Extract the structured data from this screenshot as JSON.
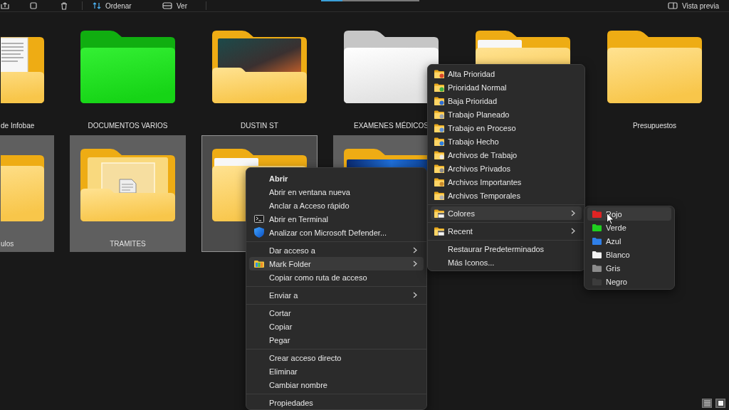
{
  "toolbar": {
    "sort_button": "Ordenar",
    "view_button": "Ver",
    "preview_button": "Vista previa"
  },
  "folders": [
    {
      "label": "de Infobae",
      "kind": "papers",
      "selected": false,
      "focused": false
    },
    {
      "label": "DOCUMENTOS VARIOS",
      "kind": "green",
      "selected": false,
      "focused": false
    },
    {
      "label": "DUSTIN ST",
      "kind": "photo",
      "selected": false,
      "focused": false
    },
    {
      "label": "EXAMENES MÉDICOS",
      "kind": "white",
      "selected": false,
      "focused": false
    },
    {
      "kind": "sheet",
      "selected": false,
      "focused": false
    },
    {
      "label": "Presupuestos",
      "kind": "plain",
      "selected": false,
      "focused": false
    },
    {
      "label": "ulos",
      "kind": "plain",
      "selected": true,
      "focused": false
    },
    {
      "label": "TRAMITES",
      "kind": "thumbnail",
      "selected": true,
      "focused": false
    },
    {
      "kind": "sheet",
      "selected": true,
      "focused": true
    },
    {
      "kind": "wallpaper",
      "selected": true,
      "focused": false
    }
  ],
  "context_menu": {
    "groups": [
      {
        "items": [
          {
            "label": "Abrir",
            "kind": "default",
            "submenu": false,
            "selected": false
          },
          {
            "label": "Abrir en ventana nueva",
            "kind": "plain",
            "submenu": false,
            "selected": false
          },
          {
            "label": "Anclar a Acceso rápido",
            "kind": "plain",
            "submenu": false,
            "selected": false
          },
          {
            "label": "Abrir en Terminal",
            "kind": "terminal",
            "submenu": false,
            "selected": false
          },
          {
            "label": "Analizar con Microsoft Defender...",
            "kind": "shield",
            "submenu": false,
            "selected": false
          }
        ]
      },
      {
        "items": [
          {
            "label": "Dar acceso a",
            "kind": "plain",
            "submenu": true,
            "selected": false
          },
          {
            "label": "Mark Folder",
            "kind": "tag",
            "submenu": true,
            "selected": true
          },
          {
            "label": "Copiar como ruta de acceso",
            "kind": "plain",
            "submenu": false,
            "selected": false
          }
        ]
      },
      {
        "items": [
          {
            "label": "Enviar a",
            "kind": "plain",
            "submenu": true,
            "selected": false
          }
        ]
      },
      {
        "items": [
          {
            "label": "Cortar",
            "kind": "plain",
            "submenu": false,
            "selected": false
          },
          {
            "label": "Copiar",
            "kind": "plain",
            "submenu": false,
            "selected": false
          },
          {
            "label": "Pegar",
            "kind": "plain",
            "submenu": false,
            "selected": false
          }
        ]
      },
      {
        "items": [
          {
            "label": "Crear acceso directo",
            "kind": "plain",
            "submenu": false,
            "selected": false
          },
          {
            "label": "Eliminar",
            "kind": "plain",
            "submenu": false,
            "selected": false
          },
          {
            "label": "Cambiar nombre",
            "kind": "plain",
            "submenu": false,
            "selected": false
          }
        ]
      },
      {
        "items": [
          {
            "label": "Propiedades",
            "kind": "plain",
            "submenu": false,
            "selected": false
          }
        ]
      }
    ]
  },
  "mark_folder_menu": {
    "groups": [
      {
        "items": [
          {
            "label": "Alta Prioridad",
            "kind": "badge",
            "color": "#d9482b",
            "submenu": false,
            "selected": false
          },
          {
            "label": "Prioridad Normal",
            "kind": "badge",
            "color": "#3cb043",
            "submenu": false,
            "selected": false
          },
          {
            "label": "Baja Prioridad",
            "kind": "badge",
            "color": "#2f6fd6",
            "submenu": false,
            "selected": false
          },
          {
            "label": "Trabajo Planeado",
            "kind": "badge",
            "color": "#9aa3ad",
            "submenu": false,
            "selected": false
          },
          {
            "label": "Trabajo en Proceso",
            "kind": "badge",
            "color": "#5b8fd9",
            "submenu": false,
            "selected": false
          },
          {
            "label": "Trabajo Hecho",
            "kind": "badge",
            "color": "#2e7fe0",
            "submenu": false,
            "selected": false
          },
          {
            "label": "Archivos de Trabajo",
            "kind": "badge",
            "color": "#e8e8e8",
            "submenu": false,
            "selected": false
          },
          {
            "label": "Archivos Privados",
            "kind": "badge",
            "color": "#8a8a8a",
            "submenu": false,
            "selected": false
          },
          {
            "label": "Archivos Importantes",
            "kind": "badge",
            "color": "#c98a2b",
            "submenu": false,
            "selected": false
          },
          {
            "label": "Archivos Temporales",
            "kind": "badge",
            "color": "#b0b0b0",
            "submenu": false,
            "selected": false
          }
        ]
      },
      {
        "items": [
          {
            "label": "Colores",
            "kind": "window",
            "submenu": true,
            "selected": true
          }
        ]
      },
      {
        "items": [
          {
            "label": "Recent",
            "kind": "window",
            "submenu": true,
            "selected": false
          }
        ]
      },
      {
        "items": [
          {
            "label": "Restaurar Predeterminados",
            "kind": "plain",
            "submenu": false,
            "selected": false
          },
          {
            "label": "Más Iconos...",
            "kind": "plain",
            "submenu": false,
            "selected": false
          }
        ]
      }
    ]
  },
  "colors_menu": {
    "items": [
      {
        "label": "Rojo",
        "color": "#e02424",
        "selected": true
      },
      {
        "label": "Verde",
        "color": "#1fd01f",
        "selected": false
      },
      {
        "label": "Azul",
        "color": "#2f7fe8",
        "selected": false
      },
      {
        "label": "Blanco",
        "color": "#f2f2f2",
        "selected": false
      },
      {
        "label": "Gris",
        "color": "#8c8c8c",
        "selected": false
      },
      {
        "label": "Negro",
        "color": "#3c3c3c",
        "selected": false
      }
    ]
  }
}
